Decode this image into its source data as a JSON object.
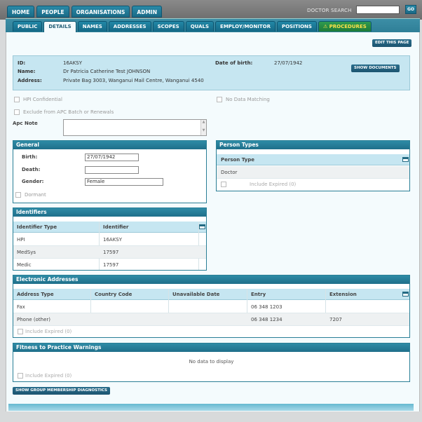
{
  "topnav": [
    "HOME",
    "PEOPLE",
    "ORGANISATIONS",
    "ADMIN"
  ],
  "doctor_search": {
    "label": "DOCTOR SEARCH",
    "value": "",
    "go": "GO"
  },
  "subtabs": [
    "PUBLIC",
    "DETAILS",
    "NAMES",
    "ADDRESSES",
    "SCOPES",
    "QUALS",
    "EMPLOY/MONITOR",
    "POSITIONS",
    "PROCEDURES"
  ],
  "active_tab": "DETAILS",
  "edit_button": "EDIT THIS PAGE",
  "person": {
    "id_label": "ID:",
    "id": "16AKSY",
    "name_label": "Name:",
    "name": "Dr Patricia Catherine Test JOHNSON",
    "address_label": "Address:",
    "address": "Private Bag 3003, Wanganui Mail Centre, Wanganui 4540",
    "dob_label": "Date of birth:",
    "dob": "27/07/1942",
    "show_documents": "SHOW DOCUMENTS"
  },
  "checks": {
    "hpi_confidential": "HPI Confidential",
    "no_data_matching": "No Data Matching",
    "exclude_apc": "Exclude from APC Batch or Renewals"
  },
  "apc_note": {
    "label": "Apc Note",
    "value": ""
  },
  "general": {
    "title": "General",
    "birth_label": "Birth:",
    "birth": "27/07/1942",
    "death_label": "Death:",
    "death": "",
    "gender_label": "Gender:",
    "gender": "Female",
    "dormant": "Dormant"
  },
  "person_types": {
    "title": "Person Types",
    "header": "Person Type",
    "rows": [
      "Doctor"
    ],
    "include_expired": "Include Expired (0)"
  },
  "identifiers": {
    "title": "Identifiers",
    "headers": [
      "Identifier Type",
      "Identifier"
    ],
    "rows": [
      [
        "HPI",
        "16AKSY"
      ],
      [
        "MedSys",
        "17597"
      ],
      [
        "Medic",
        "17597"
      ]
    ]
  },
  "electronic_addresses": {
    "title": "Electronic Addresses",
    "headers": [
      "Address Type",
      "Country Code",
      "Unavailable Date",
      "Entry",
      "Extension"
    ],
    "rows": [
      [
        "Fax",
        "",
        "",
        "06 348 1203",
        ""
      ],
      [
        "Phone (other)",
        "",
        "",
        "06 348 1234",
        "7207"
      ]
    ],
    "include_expired": "Include Expired (0)"
  },
  "fitness": {
    "title": "Fitness to Practice Warnings",
    "empty": "No data to display",
    "include_expired": "Include Expired (0)"
  },
  "diagnostics_button": "SHOW GROUP MEMBERSHIP DIAGNOSTICS"
}
